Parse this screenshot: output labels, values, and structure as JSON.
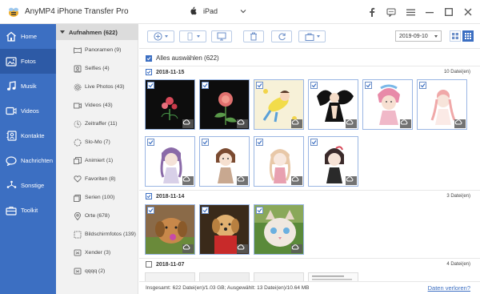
{
  "app": {
    "title": "AnyMP4 iPhone Transfer Pro",
    "device": "iPad"
  },
  "colors": {
    "accent": "#3c6fc2",
    "nav_active": "#2d5aa6"
  },
  "nav": [
    {
      "label": "Home",
      "icon": "home-icon"
    },
    {
      "label": "Fotos",
      "icon": "photo-icon",
      "active": true
    },
    {
      "label": "Musik",
      "icon": "music-icon"
    },
    {
      "label": "Videos",
      "icon": "video-icon"
    },
    {
      "label": "Kontakte",
      "icon": "contacts-icon"
    },
    {
      "label": "Nachrichten",
      "icon": "message-icon"
    },
    {
      "label": "Sonstige",
      "icon": "other-icon"
    },
    {
      "label": "Toolkit",
      "icon": "toolkit-icon"
    }
  ],
  "categories": {
    "header": "Aufnahmen (622)",
    "items": [
      {
        "label": "Panoramen (9)",
        "icon": "panorama-icon"
      },
      {
        "label": "Selfies (4)",
        "icon": "selfie-icon"
      },
      {
        "label": "Live Photos (43)",
        "icon": "live-photo-icon"
      },
      {
        "label": "Videos (43)",
        "icon": "video-icon"
      },
      {
        "label": "Zeitraffer (11)",
        "icon": "timelapse-icon"
      },
      {
        "label": "Slo-Mo (7)",
        "icon": "slomo-icon"
      },
      {
        "label": "Animiert (1)",
        "icon": "animated-icon"
      },
      {
        "label": "Favoriten (8)",
        "icon": "heart-icon"
      },
      {
        "label": "Serien (100)",
        "icon": "burst-icon"
      },
      {
        "label": "Orte (678)",
        "icon": "location-icon"
      },
      {
        "label": "Bildschirmfotos (139)",
        "icon": "screenshot-icon"
      },
      {
        "label": "Xender (3)",
        "icon": "folder-icon"
      },
      {
        "label": "qqqq (2)",
        "icon": "folder-icon"
      }
    ]
  },
  "toolbar": {
    "date": "2019-09-10"
  },
  "content": {
    "select_all": "Alles auswählen (622)",
    "groups": [
      {
        "date": "2018-11-15",
        "count": "10 Datei(en)",
        "checked": true
      },
      {
        "date": "2018-11-14",
        "count": "3 Datei(en)",
        "checked": true
      },
      {
        "date": "2018-11-07",
        "count": "4 Datei(en)",
        "checked": false
      }
    ]
  },
  "status": {
    "summary": "Insgesamt: 622 Datei(en)/1.03 GB; Ausgewählt: 13 Datei(en)/10.64 MB",
    "lost_link": "Daten verloren?"
  }
}
